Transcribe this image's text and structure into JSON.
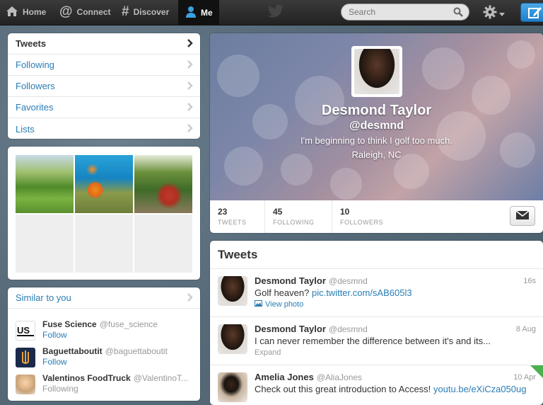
{
  "topbar": {
    "nav": [
      {
        "label": "Home",
        "icon": "home-icon"
      },
      {
        "label": "Connect",
        "icon": "at-icon"
      },
      {
        "label": "Discover",
        "icon": "hash-icon"
      },
      {
        "label": "Me",
        "icon": "person-icon"
      }
    ],
    "search_placeholder": "Search"
  },
  "menu": {
    "items": [
      {
        "label": "Tweets"
      },
      {
        "label": "Following"
      },
      {
        "label": "Followers"
      },
      {
        "label": "Favorites"
      },
      {
        "label": "Lists"
      }
    ]
  },
  "similar": {
    "title": "Similar to you",
    "accounts": [
      {
        "name": "Fuse Science",
        "handle": "@fuse_science",
        "action": "Follow"
      },
      {
        "name": "Baguettaboutit",
        "handle": "@baguettaboutit",
        "action": "Follow"
      },
      {
        "name": "Valentinos FoodTruck",
        "handle": "@ValentinoT...",
        "action": "Following"
      }
    ]
  },
  "profile": {
    "name": "Desmond Taylor",
    "handle": "@desmnd",
    "bio": "I'm beginning to think I golf too much.",
    "location": "Raleigh, NC",
    "stats": [
      {
        "value": "23",
        "label": "TWEETS"
      },
      {
        "value": "45",
        "label": "FOLLOWING"
      },
      {
        "value": "10",
        "label": "FOLLOWERS"
      }
    ]
  },
  "tweets": {
    "title": "Tweets",
    "items": [
      {
        "name": "Desmond Taylor",
        "handle": "@desmnd",
        "time": "16s",
        "text": "Golf heaven?",
        "link": "pic.twitter.com/sAB605l3",
        "extra": "View photo"
      },
      {
        "name": "Desmond Taylor",
        "handle": "@desmnd",
        "time": "8 Aug",
        "text": "I can never remember the difference between it's and its...",
        "link": "",
        "extra": "Expand"
      },
      {
        "name": "Amelia Jones",
        "handle": "@AliaJones",
        "time": "10 Apr",
        "text": "Check out this great introduction to Access!",
        "link": "youtu.be/eXiCza050ug",
        "extra": ""
      }
    ]
  },
  "colors": {
    "link": "#2a7db5",
    "topbar": "#222222",
    "compose": "#1f7fcc"
  }
}
